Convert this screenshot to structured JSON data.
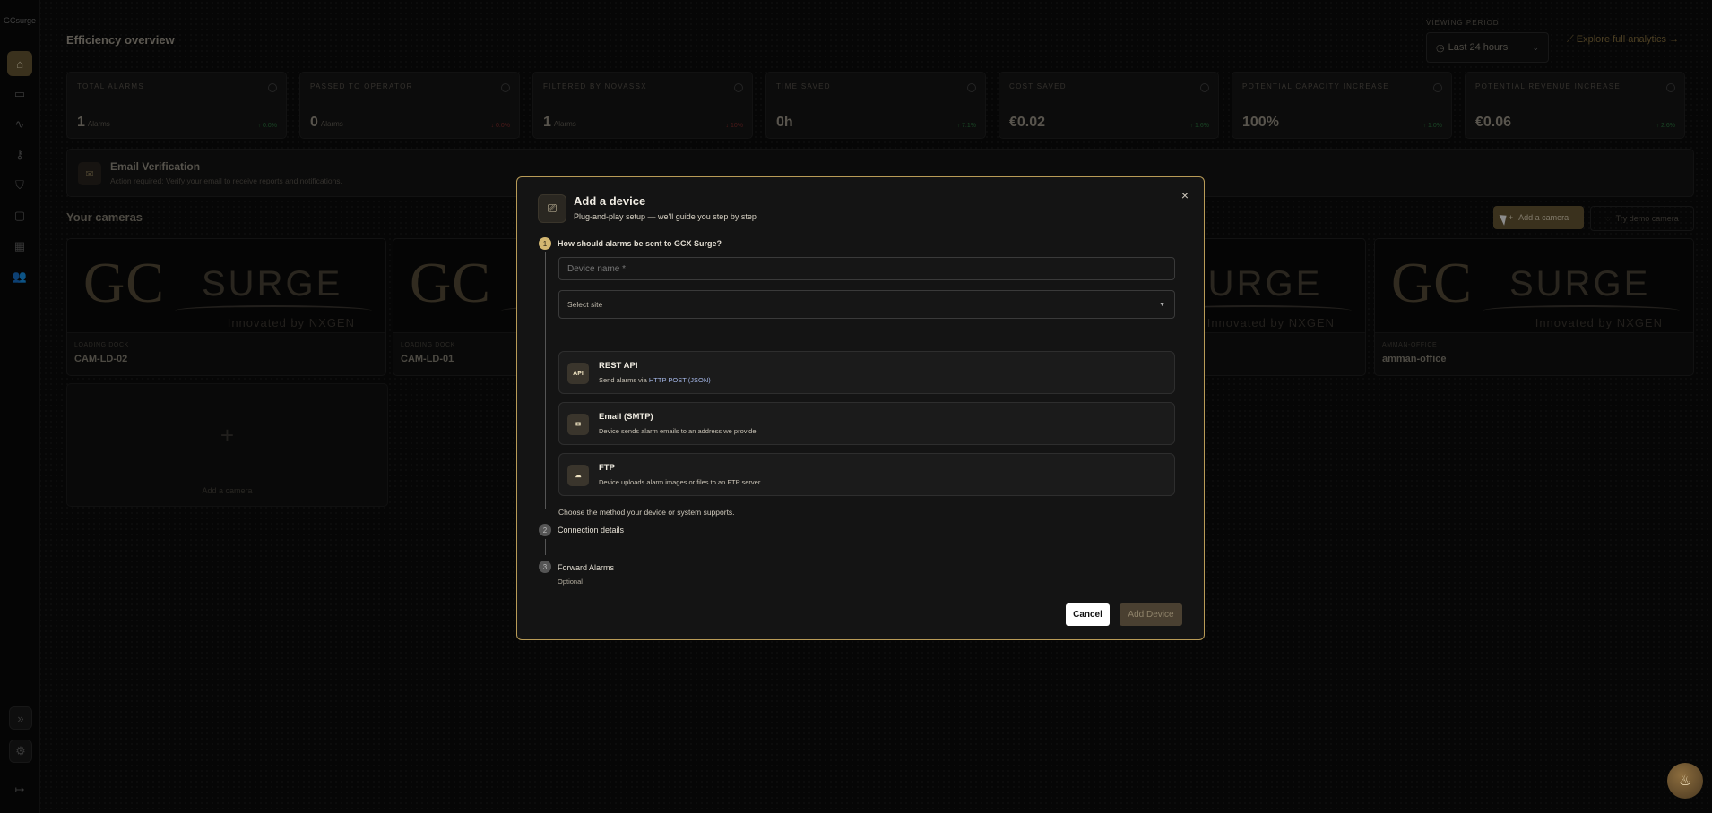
{
  "sidebar": {
    "brand": "GCsurge",
    "icons": [
      "home-icon",
      "card-icon",
      "activity-icon",
      "key-icon",
      "shield-icon",
      "camera-icon",
      "grid-icon",
      "users-icon"
    ],
    "expand_glyph": "»",
    "settings_glyph": "⚙",
    "logout_glyph": "↦"
  },
  "header": {
    "title": "Efficiency overview",
    "period_label": "VIEWING PERIOD",
    "period_value": "Last 24 hours",
    "explore_link": "Explore full analytics"
  },
  "stats": [
    {
      "label": "TOTAL ALARMS",
      "value": "1",
      "unit": "Alarms",
      "trend": "↑ 0.0%",
      "dir": "up"
    },
    {
      "label": "PASSED TO OPERATOR",
      "value": "0",
      "unit": "Alarms",
      "trend": "↓ 0.0%",
      "dir": "down"
    },
    {
      "label": "FILTERED BY NOVASSX",
      "value": "1",
      "unit": "Alarms",
      "trend": "↓ 10%",
      "dir": "down"
    },
    {
      "label": "TIME SAVED",
      "value": "0h",
      "unit": "",
      "trend": "↑ 7.1%",
      "dir": "up"
    },
    {
      "label": "COST SAVED",
      "value": "€0.02",
      "unit": "",
      "trend": "↑ 1.6%",
      "dir": "up"
    },
    {
      "label": "POTENTIAL CAPACITY INCREASE",
      "value": "100%",
      "unit": "",
      "trend": "↑ 1.0%",
      "dir": "up"
    },
    {
      "label": "POTENTIAL REVENUE INCREASE",
      "value": "€0.06",
      "unit": "",
      "trend": "↑ 2.6%",
      "dir": "up"
    }
  ],
  "banner": {
    "title": "Email Verification",
    "subtitle": "Action required: Verify your email to receive reports and notifications."
  },
  "cameras_section": {
    "title": "Your cameras",
    "add_button": "Add a camera",
    "demo_button": "Try demo camera",
    "cards": [
      {
        "site": "LOADING DOCK",
        "name": "CAM-LD-02"
      },
      {
        "site": "LOADING DOCK",
        "name": "CAM-LD-01"
      },
      {
        "site": "AMMAN-OFFICE",
        "name": "amman-office"
      }
    ],
    "thumb_logo": {
      "gc": "GC",
      "surge": "SURGE",
      "tagline": "Innovated by NXGEN"
    },
    "add_tile": {
      "plus": "+",
      "label": "Add a camera"
    }
  },
  "modal": {
    "title": "Add a device",
    "subtitle": "Plug-and-play setup — we'll guide you step by step",
    "close": "×",
    "steps": [
      {
        "num": "1",
        "label": "How should alarms be sent to GCX Surge?"
      },
      {
        "num": "2",
        "label": "Connection details"
      },
      {
        "num": "3",
        "label": "Forward Alarms",
        "sub": "Optional"
      }
    ],
    "device_name_placeholder": "Device name *",
    "site_placeholder": "Select site",
    "method_hint": "Choose the method your device or system supports.",
    "methods": [
      {
        "icon": "API",
        "title": "REST API",
        "desc_prefix": "Send alarms via ",
        "desc_highlight": "HTTP POST (JSON)"
      },
      {
        "icon": "✉",
        "title": "Email (SMTP)",
        "desc": "Device sends alarm emails to an address we provide"
      },
      {
        "icon": "☁",
        "title": "FTP",
        "desc": "Device uploads alarm images or files to an FTP server"
      }
    ],
    "cancel": "Cancel",
    "add": "Add Device"
  },
  "colors": {
    "accent": "#b89b57",
    "bg": "#0b0b0b"
  }
}
